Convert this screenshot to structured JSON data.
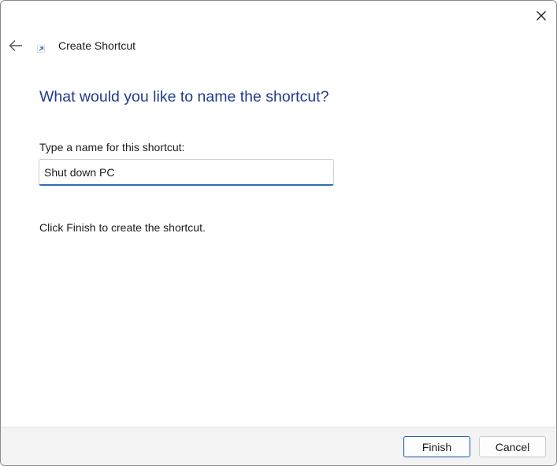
{
  "window": {
    "wizard_title": "Create Shortcut",
    "icons": {
      "close": "close-icon",
      "back": "back-arrow-icon",
      "wizard": "shortcut-arrow-icon"
    }
  },
  "main": {
    "heading": "What would you like to name the shortcut?",
    "field_label": "Type a name for this shortcut:",
    "name_value": "Shut down PC",
    "info_text": "Click Finish to create the shortcut."
  },
  "footer": {
    "finish_label": "Finish",
    "cancel_label": "Cancel"
  },
  "colors": {
    "heading": "#1f3d8a",
    "accent": "#2c6fb7",
    "footer_bg": "#f3f3f3"
  }
}
